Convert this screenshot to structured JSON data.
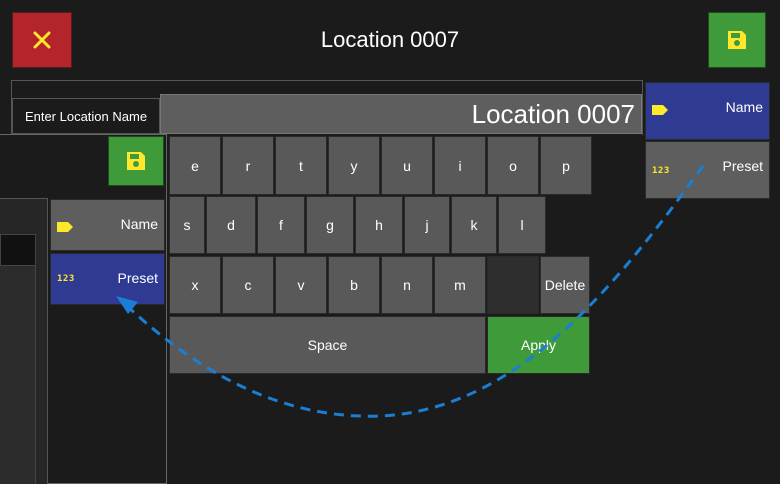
{
  "header": {
    "title": "Location 0007",
    "close_icon": "close-icon",
    "save_icon": "save-icon"
  },
  "name_field": {
    "label": "Enter Location Name",
    "value": "Location 0007"
  },
  "side_menu": {
    "name_label": "Name",
    "preset_label": "Preset",
    "preset_icon_text": "123"
  },
  "keyboard": {
    "row1": [
      "e",
      "r",
      "t",
      "y",
      "u",
      "i",
      "o",
      "p"
    ],
    "row2": [
      "s",
      "d",
      "f",
      "g",
      "h",
      "j",
      "k",
      "l"
    ],
    "row3": [
      "x",
      "c",
      "v",
      "b",
      "n",
      "m"
    ],
    "delete_label": "Delete",
    "space_label": "Space",
    "apply_label": "Apply"
  },
  "colors": {
    "close_red": "#b3252b",
    "save_green": "#3f9a3a",
    "preset_blue": "#2f3b92",
    "tag_yellow": "#ffe82b",
    "arrow_blue": "#1a7fd4"
  }
}
